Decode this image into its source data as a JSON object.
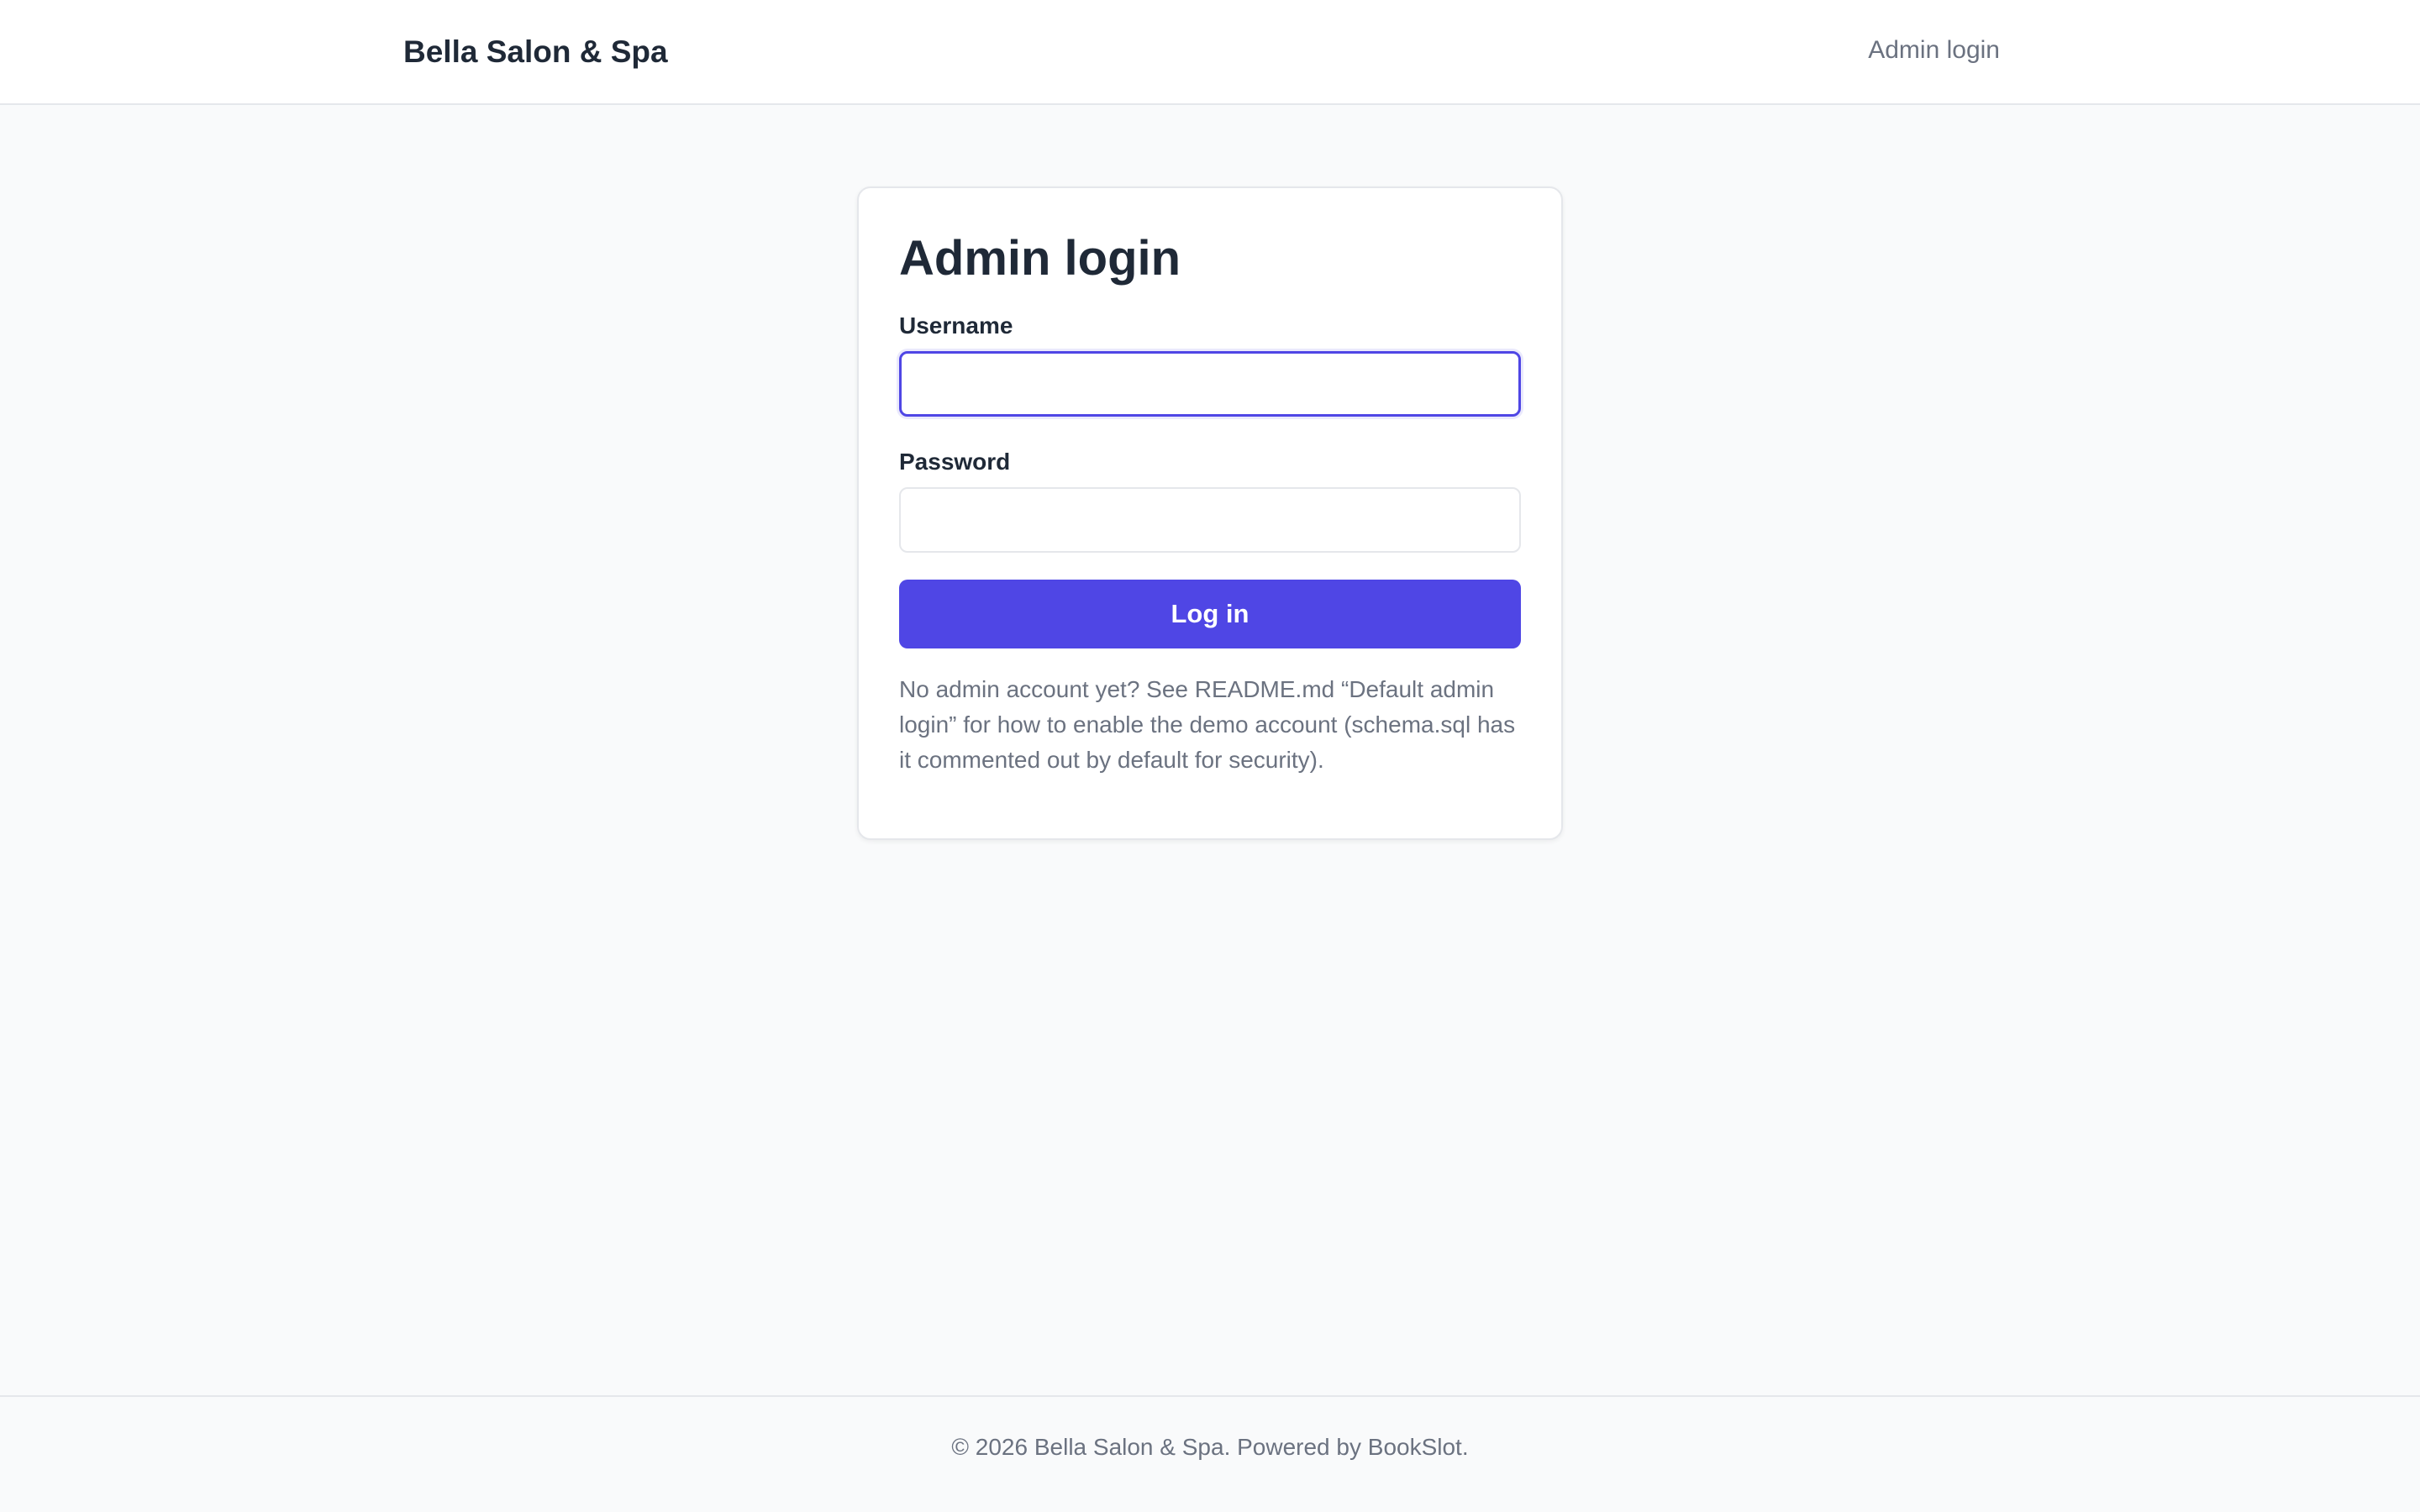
{
  "header": {
    "brand": "Bella Salon & Spa",
    "nav_admin_login": "Admin login"
  },
  "login": {
    "title": "Admin login",
    "username_label": "Username",
    "username_value": "",
    "password_label": "Password",
    "password_value": "",
    "submit_label": "Log in",
    "help_text": "No admin account yet? See README.md “Default admin login” for how to enable the demo account (schema.sql has it commented out by default for security)."
  },
  "footer": {
    "text": "© 2026 Bella Salon & Spa. Powered by BookSlot."
  },
  "colors": {
    "accent": "#4f46e5",
    "background": "#f9fafb",
    "text_primary": "#1f2937",
    "text_muted": "#6b7280"
  }
}
